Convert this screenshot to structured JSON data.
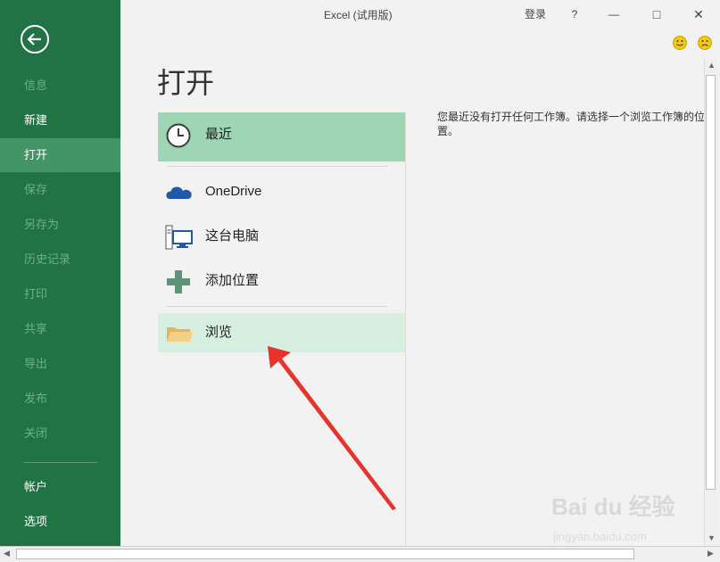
{
  "window": {
    "title": "Excel (试用版)",
    "signin": "登录",
    "help": "?",
    "min": "—",
    "max": "□",
    "close": "✕"
  },
  "sidebar": {
    "items": [
      {
        "label": "信息",
        "state": "disabled"
      },
      {
        "label": "新建",
        "state": "normal"
      },
      {
        "label": "打开",
        "state": "active"
      },
      {
        "label": "保存",
        "state": "disabled"
      },
      {
        "label": "另存为",
        "state": "disabled"
      },
      {
        "label": "历史记录",
        "state": "disabled"
      },
      {
        "label": "打印",
        "state": "disabled"
      },
      {
        "label": "共享",
        "state": "disabled"
      },
      {
        "label": "导出",
        "state": "disabled"
      },
      {
        "label": "发布",
        "state": "disabled"
      },
      {
        "label": "关闭",
        "state": "disabled"
      }
    ],
    "bottom": [
      {
        "label": "帐户"
      },
      {
        "label": "选项"
      }
    ]
  },
  "main": {
    "title": "打开",
    "locations": [
      {
        "label": "最近",
        "icon": "clock-icon"
      },
      {
        "label": "OneDrive",
        "icon": "cloud-icon"
      },
      {
        "label": "这台电脑",
        "icon": "computer-icon"
      },
      {
        "label": "添加位置",
        "icon": "plus-icon"
      },
      {
        "label": "浏览",
        "icon": "folder-icon"
      }
    ],
    "message": "您最近没有打开任何工作簿。请选择一个浏览工作簿的位置。"
  },
  "watermark": {
    "brand": "Bai du 经验",
    "url": "jingyan.baidu.com"
  },
  "colors": {
    "sidebar": "#217346",
    "active": "#439467",
    "recent_bg": "#9ed5b4",
    "browse_bg": "#d6efe0",
    "annotation": "#e8332c"
  }
}
